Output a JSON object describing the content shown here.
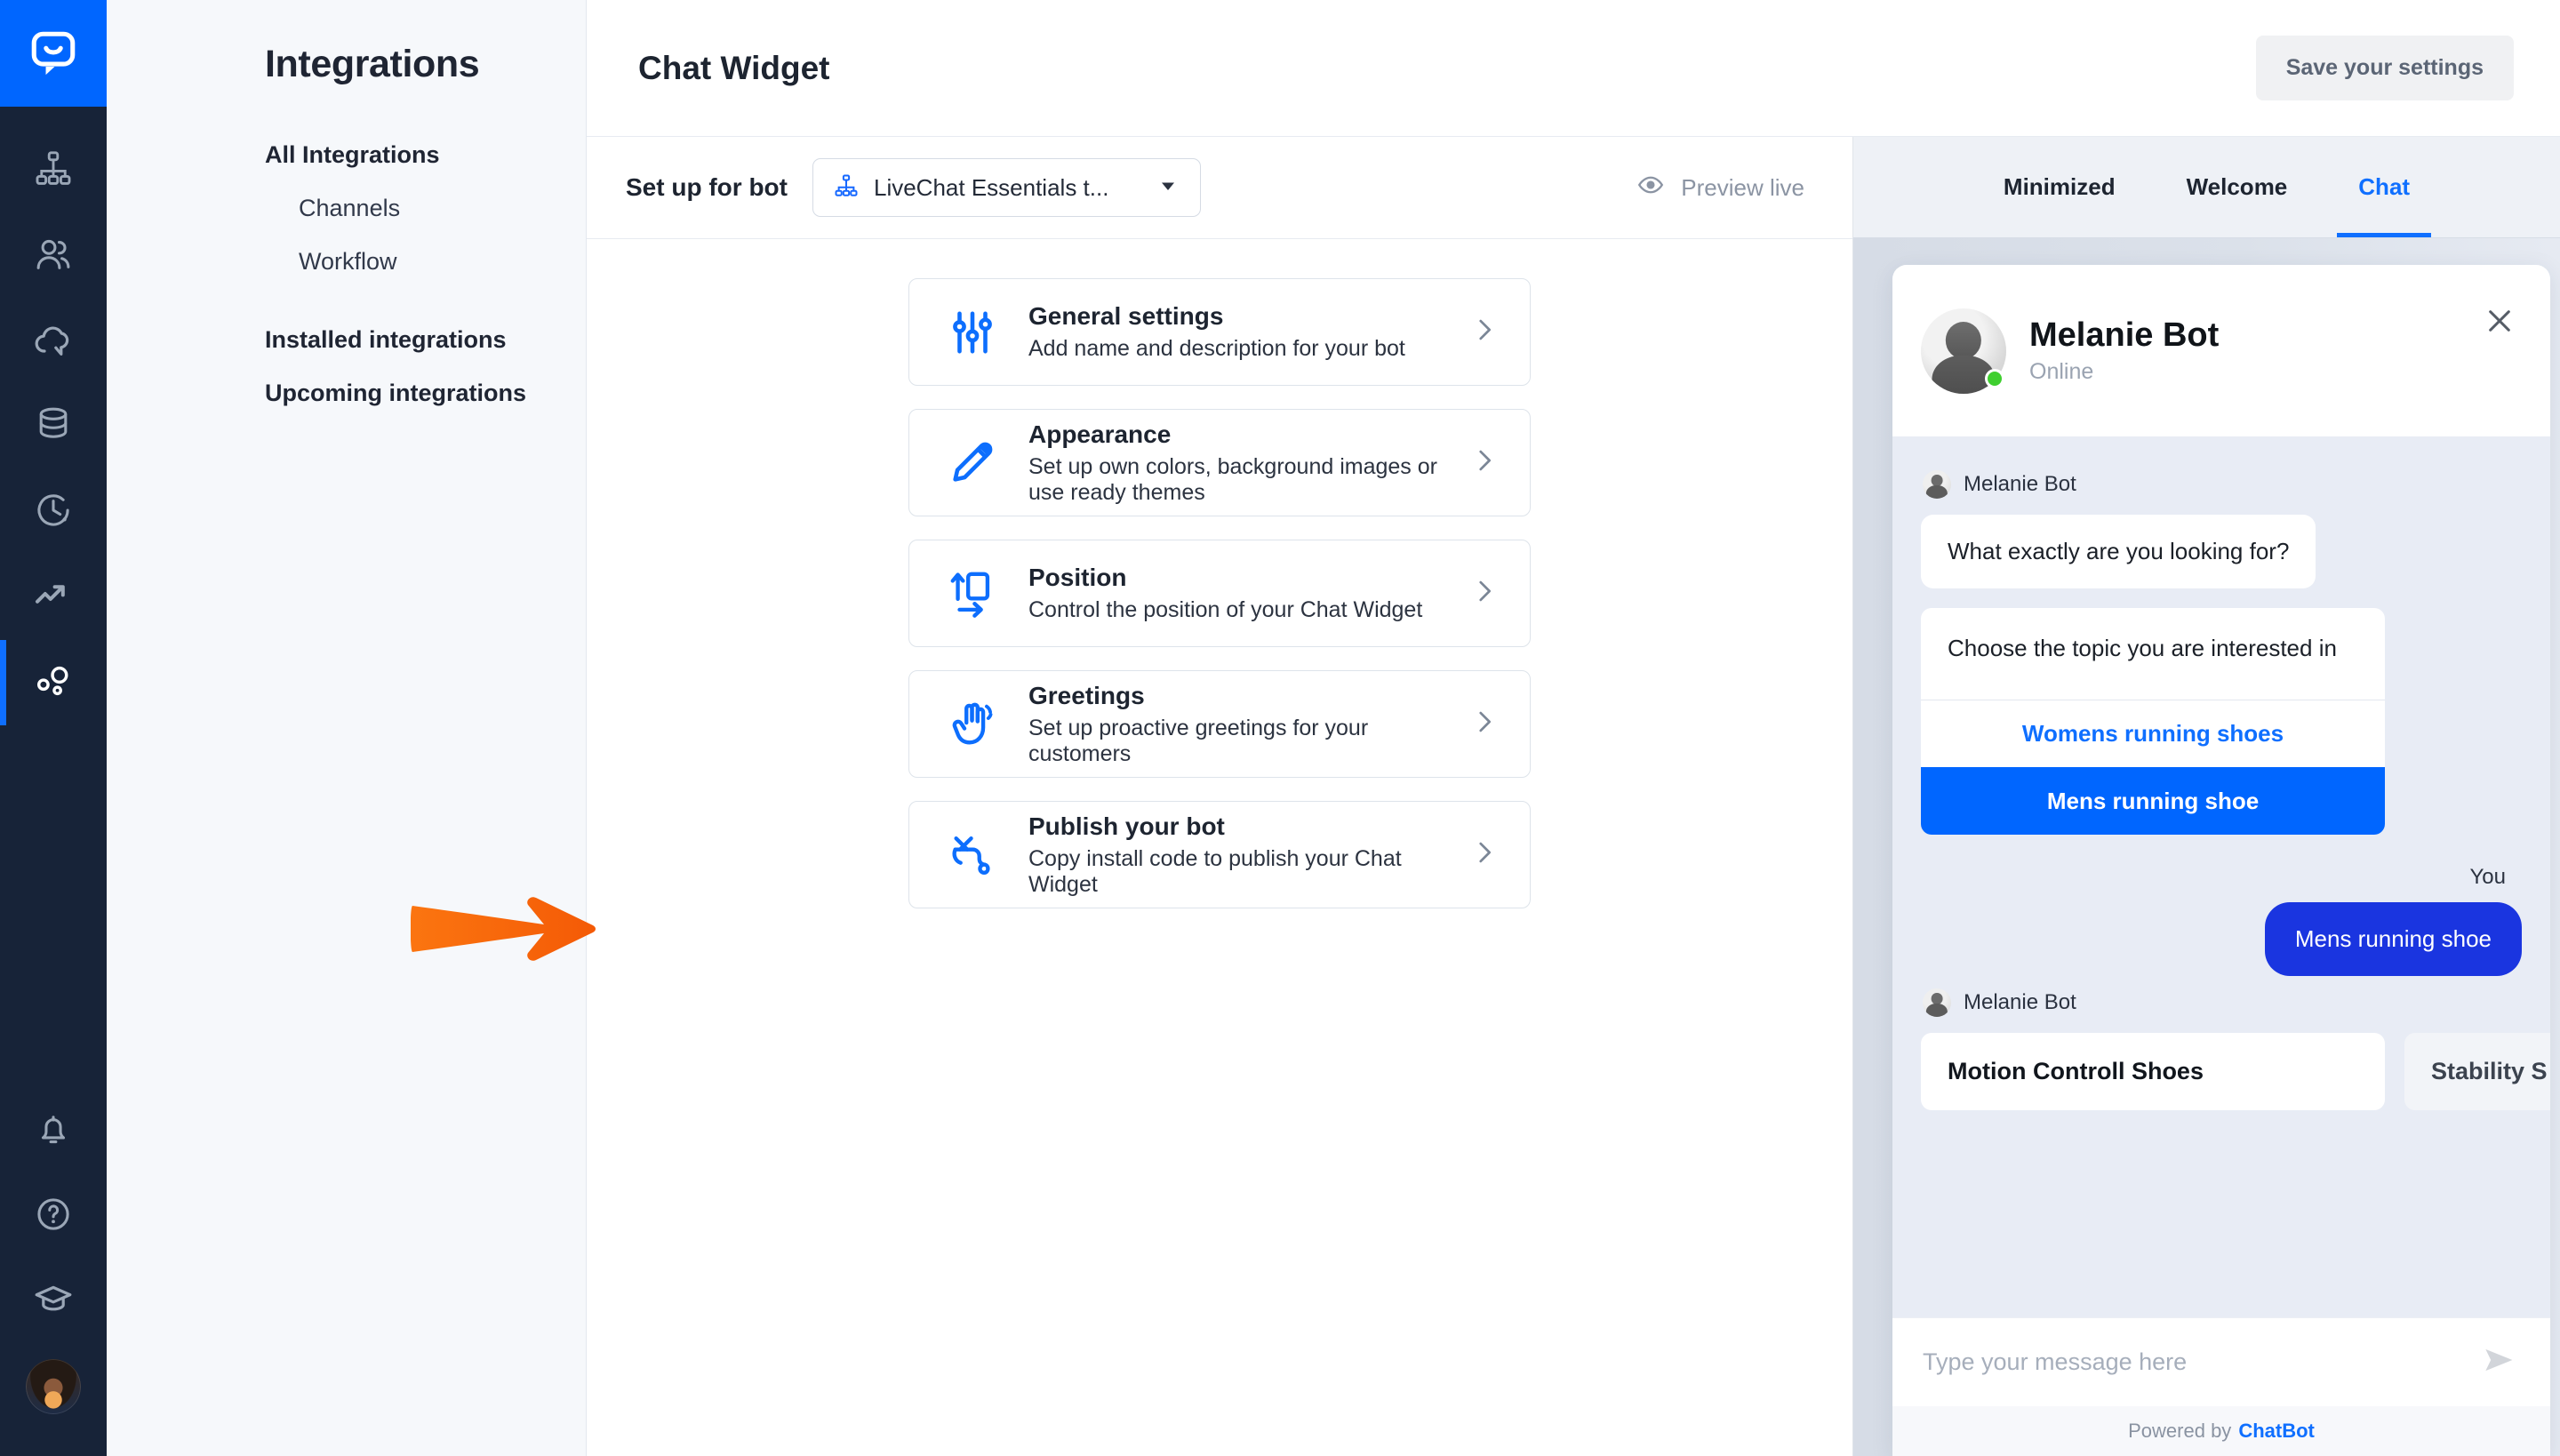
{
  "rail": {
    "logo": "chatbot-logo",
    "items": [
      {
        "icon": "hierarchy-icon",
        "name": "stories"
      },
      {
        "icon": "users-icon",
        "name": "users"
      },
      {
        "icon": "cloud-chat-icon",
        "name": "chats"
      },
      {
        "icon": "database-icon",
        "name": "knowledge"
      },
      {
        "icon": "clock-history-icon",
        "name": "archives"
      },
      {
        "icon": "trending-up-icon",
        "name": "reports"
      },
      {
        "icon": "integrations-icon",
        "name": "integrations",
        "active": true
      }
    ],
    "bottom": [
      {
        "icon": "bell-icon",
        "name": "notifications"
      },
      {
        "icon": "help-circle-icon",
        "name": "help"
      },
      {
        "icon": "graduation-cap-icon",
        "name": "academy"
      },
      {
        "icon": "avatar",
        "name": "account"
      }
    ]
  },
  "nav": {
    "title": "Integrations",
    "items": [
      {
        "label": "All Integrations",
        "level": "top"
      },
      {
        "label": "Channels",
        "level": "sub"
      },
      {
        "label": "Workflow",
        "level": "sub"
      },
      {
        "label": "Installed integrations",
        "level": "top"
      },
      {
        "label": "Upcoming integrations",
        "level": "top"
      }
    ]
  },
  "header": {
    "title": "Chat Widget",
    "save_label": "Save your settings"
  },
  "setup": {
    "label": "Set up for bot",
    "bot_name": "LiveChat Essentials t...",
    "bot_icon": "hierarchy-icon",
    "caret_icon": "chevron-down-icon",
    "preview_label": "Preview live",
    "preview_icon": "eye-icon"
  },
  "cards": [
    {
      "icon": "sliders-icon",
      "title": "General settings",
      "subtitle": "Add name and description for your bot",
      "chevron": "chevron-right-icon"
    },
    {
      "icon": "pencil-icon",
      "title": "Appearance",
      "subtitle": "Set up own colors, background images or use ready themes",
      "chevron": "chevron-right-icon"
    },
    {
      "icon": "position-icon",
      "title": "Position",
      "subtitle": "Control the position of your Chat Widget",
      "chevron": "chevron-right-icon"
    },
    {
      "icon": "waving-hand-icon",
      "title": "Greetings",
      "subtitle": "Set up proactive greetings for your customers",
      "chevron": "chevron-right-icon"
    },
    {
      "icon": "plug-icon",
      "title": "Publish your bot",
      "subtitle": "Copy install code to publish your Chat Widget",
      "chevron": "chevron-right-icon"
    }
  ],
  "preview": {
    "tabs": [
      {
        "label": "Minimized",
        "active": false
      },
      {
        "label": "Welcome",
        "active": false
      },
      {
        "label": "Chat",
        "active": true
      }
    ],
    "widget": {
      "bot_name": "Melanie Bot",
      "status": "Online",
      "close_icon": "close-icon",
      "messages": [
        {
          "type": "author",
          "name": "Melanie Bot"
        },
        {
          "type": "bot_bubble",
          "text": "What exactly are you looking for?"
        },
        {
          "type": "choice_card",
          "text": "Choose the topic you are interested in",
          "buttons": [
            {
              "label": "Womens running shoes",
              "primary": false
            },
            {
              "label": "Mens running shoe",
              "primary": true
            }
          ]
        },
        {
          "type": "you_label",
          "text": "You"
        },
        {
          "type": "user_bubble",
          "text": "Mens running shoe"
        },
        {
          "type": "author",
          "name": "Melanie Bot"
        },
        {
          "type": "tiles",
          "items": [
            {
              "label": "Motion Controll Shoes",
              "faded": false
            },
            {
              "label": "Stability S",
              "faded": true
            }
          ]
        }
      ],
      "input_placeholder": "Type your message here",
      "send_icon": "send-icon",
      "footer_prefix": "Powered by",
      "footer_brand": "ChatBot"
    }
  },
  "annotation": {
    "arrow": "orange-arrow-pointing-right",
    "color": "#f96410"
  },
  "colors": {
    "brand_blue": "#0066ff",
    "rail_dark": "#172338",
    "accent_link": "#0f6fff",
    "user_bubble": "#1a35e0",
    "online_green": "#3fcf2f",
    "annotation_orange": "#f96410"
  }
}
